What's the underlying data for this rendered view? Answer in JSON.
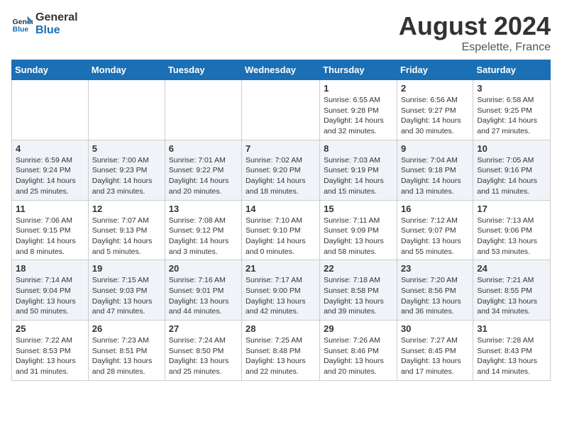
{
  "header": {
    "logo_general": "General",
    "logo_blue": "Blue",
    "month_year": "August 2024",
    "location": "Espelette, France"
  },
  "days_of_week": [
    "Sunday",
    "Monday",
    "Tuesday",
    "Wednesday",
    "Thursday",
    "Friday",
    "Saturday"
  ],
  "weeks": [
    [
      {
        "day": "",
        "info": ""
      },
      {
        "day": "",
        "info": ""
      },
      {
        "day": "",
        "info": ""
      },
      {
        "day": "",
        "info": ""
      },
      {
        "day": "1",
        "info": "Sunrise: 6:55 AM\nSunset: 9:28 PM\nDaylight: 14 hours\nand 32 minutes."
      },
      {
        "day": "2",
        "info": "Sunrise: 6:56 AM\nSunset: 9:27 PM\nDaylight: 14 hours\nand 30 minutes."
      },
      {
        "day": "3",
        "info": "Sunrise: 6:58 AM\nSunset: 9:25 PM\nDaylight: 14 hours\nand 27 minutes."
      }
    ],
    [
      {
        "day": "4",
        "info": "Sunrise: 6:59 AM\nSunset: 9:24 PM\nDaylight: 14 hours\nand 25 minutes."
      },
      {
        "day": "5",
        "info": "Sunrise: 7:00 AM\nSunset: 9:23 PM\nDaylight: 14 hours\nand 23 minutes."
      },
      {
        "day": "6",
        "info": "Sunrise: 7:01 AM\nSunset: 9:22 PM\nDaylight: 14 hours\nand 20 minutes."
      },
      {
        "day": "7",
        "info": "Sunrise: 7:02 AM\nSunset: 9:20 PM\nDaylight: 14 hours\nand 18 minutes."
      },
      {
        "day": "8",
        "info": "Sunrise: 7:03 AM\nSunset: 9:19 PM\nDaylight: 14 hours\nand 15 minutes."
      },
      {
        "day": "9",
        "info": "Sunrise: 7:04 AM\nSunset: 9:18 PM\nDaylight: 14 hours\nand 13 minutes."
      },
      {
        "day": "10",
        "info": "Sunrise: 7:05 AM\nSunset: 9:16 PM\nDaylight: 14 hours\nand 11 minutes."
      }
    ],
    [
      {
        "day": "11",
        "info": "Sunrise: 7:06 AM\nSunset: 9:15 PM\nDaylight: 14 hours\nand 8 minutes."
      },
      {
        "day": "12",
        "info": "Sunrise: 7:07 AM\nSunset: 9:13 PM\nDaylight: 14 hours\nand 5 minutes."
      },
      {
        "day": "13",
        "info": "Sunrise: 7:08 AM\nSunset: 9:12 PM\nDaylight: 14 hours\nand 3 minutes."
      },
      {
        "day": "14",
        "info": "Sunrise: 7:10 AM\nSunset: 9:10 PM\nDaylight: 14 hours\nand 0 minutes."
      },
      {
        "day": "15",
        "info": "Sunrise: 7:11 AM\nSunset: 9:09 PM\nDaylight: 13 hours\nand 58 minutes."
      },
      {
        "day": "16",
        "info": "Sunrise: 7:12 AM\nSunset: 9:07 PM\nDaylight: 13 hours\nand 55 minutes."
      },
      {
        "day": "17",
        "info": "Sunrise: 7:13 AM\nSunset: 9:06 PM\nDaylight: 13 hours\nand 53 minutes."
      }
    ],
    [
      {
        "day": "18",
        "info": "Sunrise: 7:14 AM\nSunset: 9:04 PM\nDaylight: 13 hours\nand 50 minutes."
      },
      {
        "day": "19",
        "info": "Sunrise: 7:15 AM\nSunset: 9:03 PM\nDaylight: 13 hours\nand 47 minutes."
      },
      {
        "day": "20",
        "info": "Sunrise: 7:16 AM\nSunset: 9:01 PM\nDaylight: 13 hours\nand 44 minutes."
      },
      {
        "day": "21",
        "info": "Sunrise: 7:17 AM\nSunset: 9:00 PM\nDaylight: 13 hours\nand 42 minutes."
      },
      {
        "day": "22",
        "info": "Sunrise: 7:18 AM\nSunset: 8:58 PM\nDaylight: 13 hours\nand 39 minutes."
      },
      {
        "day": "23",
        "info": "Sunrise: 7:20 AM\nSunset: 8:56 PM\nDaylight: 13 hours\nand 36 minutes."
      },
      {
        "day": "24",
        "info": "Sunrise: 7:21 AM\nSunset: 8:55 PM\nDaylight: 13 hours\nand 34 minutes."
      }
    ],
    [
      {
        "day": "25",
        "info": "Sunrise: 7:22 AM\nSunset: 8:53 PM\nDaylight: 13 hours\nand 31 minutes."
      },
      {
        "day": "26",
        "info": "Sunrise: 7:23 AM\nSunset: 8:51 PM\nDaylight: 13 hours\nand 28 minutes."
      },
      {
        "day": "27",
        "info": "Sunrise: 7:24 AM\nSunset: 8:50 PM\nDaylight: 13 hours\nand 25 minutes."
      },
      {
        "day": "28",
        "info": "Sunrise: 7:25 AM\nSunset: 8:48 PM\nDaylight: 13 hours\nand 22 minutes."
      },
      {
        "day": "29",
        "info": "Sunrise: 7:26 AM\nSunset: 8:46 PM\nDaylight: 13 hours\nand 20 minutes."
      },
      {
        "day": "30",
        "info": "Sunrise: 7:27 AM\nSunset: 8:45 PM\nDaylight: 13 hours\nand 17 minutes."
      },
      {
        "day": "31",
        "info": "Sunrise: 7:28 AM\nSunset: 8:43 PM\nDaylight: 13 hours\nand 14 minutes."
      }
    ]
  ]
}
